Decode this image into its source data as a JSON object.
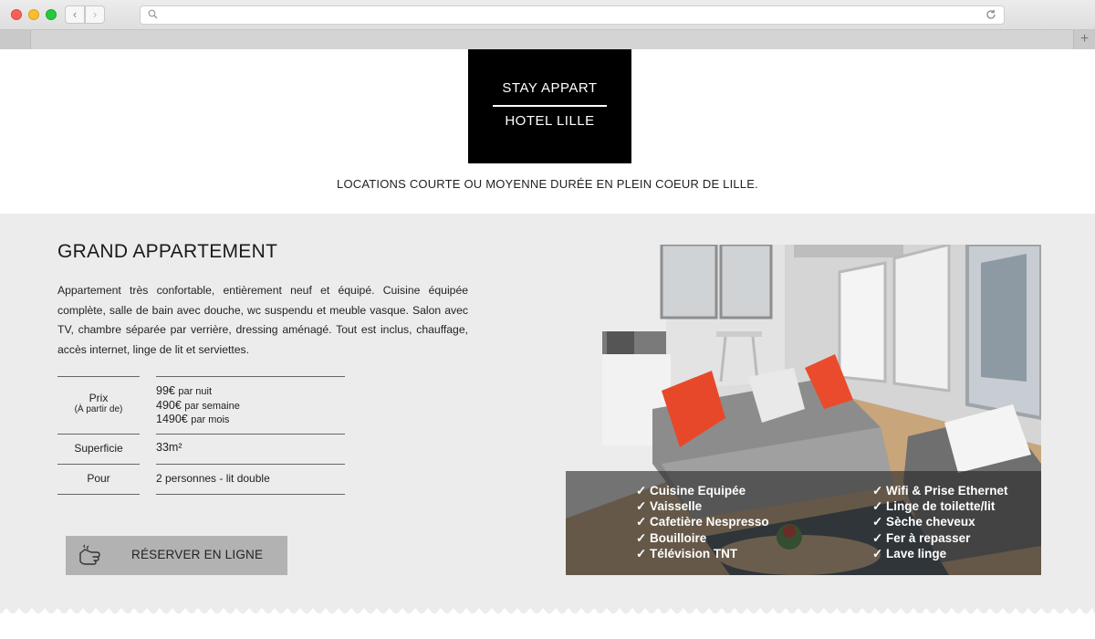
{
  "browser": {
    "url": "",
    "tab_add": "+"
  },
  "header": {
    "logo_line1": "STAY APPART",
    "logo_line2": "HOTEL LILLE",
    "tagline": "LOCATIONS COURTE OU MOYENNE DURÉE EN PLEIN COEUR DE LILLE."
  },
  "listing": {
    "title": "GRAND APPARTEMENT",
    "description": "Appartement très confortable, entièrement neuf et équipé. Cuisine équipée complète, salle de bain avec douche, wc suspendu et meuble vasque. Salon avec TV, chambre séparée par verrière, dressing aménagé. Tout est inclus, chauffage, accès internet, linge de lit et serviettes.",
    "price": {
      "label": "Prix",
      "sublabel": "(À partir de)",
      "night": "99€",
      "night_unit": "par nuit",
      "week": "490€",
      "week_unit": "par semaine",
      "month": "1490€",
      "month_unit": "par mois"
    },
    "surface": {
      "label": "Superficie",
      "value": "33m²"
    },
    "capacity": {
      "label": "Pour",
      "value": "2 personnes - lit double"
    },
    "cta_label": "RÉSERVER EN LIGNE",
    "features_left": [
      "✓ Cuisine Equipée",
      "✓ Vaisselle",
      "✓ Cafetière Nespresso",
      "✓ Bouilloire",
      "✓ Télévision TNT"
    ],
    "features_right": [
      "✓ Wifi & Prise Ethernet",
      "✓ Linge de toilette/lit",
      "✓ Sèche cheveux",
      "✓ Fer à repasser",
      "✓ Lave linge"
    ]
  },
  "colors": {
    "section_bg": "#ececec",
    "logo_bg": "#000000",
    "cta_bg": "#b2b2b2",
    "accent_cushion": "#e8482a"
  },
  "icons": {
    "cta": "hand-pointer-icon",
    "search": "search-icon",
    "reload": "reload-icon"
  }
}
